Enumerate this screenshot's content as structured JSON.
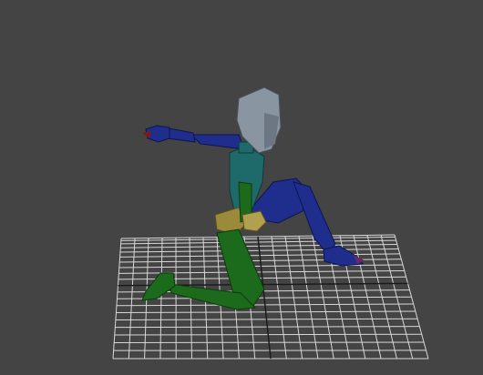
{
  "viewport": {
    "background_color": "#444444",
    "grid_color": "#d8d8d8",
    "grid_axis_color": "#1a1a1a",
    "grid_visible": true
  },
  "character": {
    "head_color": "#8a95a2",
    "left_arm_color": "#1f2d8c",
    "torso_color": "#1e6a6a",
    "right_leg_color": "#1f2d8c",
    "left_leg_color": "#1c6a1c",
    "pelvis_color": "#9a8a3a",
    "hand_color": "#b0a050"
  }
}
